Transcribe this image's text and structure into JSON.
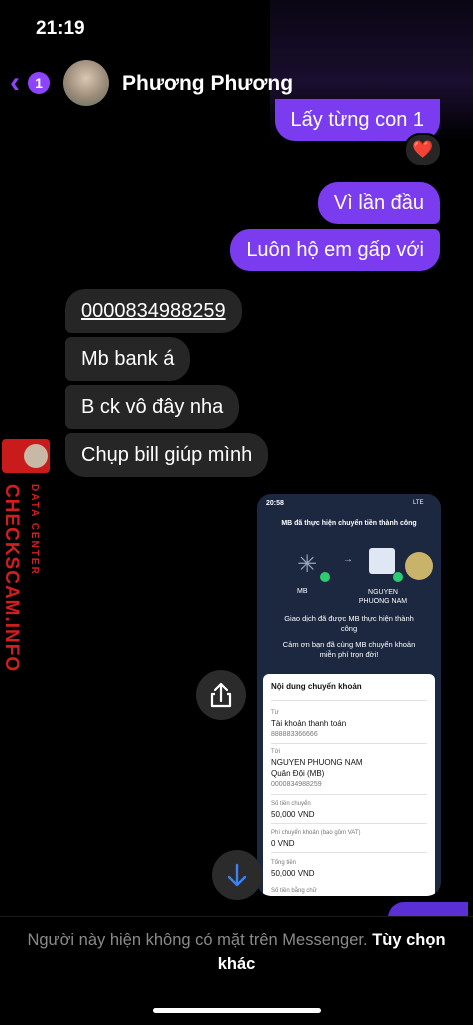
{
  "status": {
    "time": "21:19"
  },
  "header": {
    "back_count": "1",
    "contact_name": "Phương Phương"
  },
  "messages": {
    "out": [
      "Lấy từng con 1",
      "Vì lần đầu",
      "Luôn hộ em gấp với"
    ],
    "reaction": "❤️",
    "in": [
      "0000834988259",
      "Mb bank á",
      "B ck vô đây nha",
      "Chụp bill giúp mình"
    ]
  },
  "watermark": {
    "title": "CHECKSCAM.INFO",
    "subtitle": "DATA CENTER"
  },
  "screenshot": {
    "time": "20:58",
    "network": "LTE",
    "heading": "MB đã thực hiện chuyển tiền thành công",
    "from_bank": "MB",
    "to_name": "NGUYEN PHUONG NAM",
    "msg1": "Giao dịch đã được MB thực hiện thành công",
    "msg2": "Cảm ơn bạn đã cùng MB chuyển khoản miễn phí trọn đời!",
    "card_title": "Nội dung chuyển khoản",
    "from_label": "Từ",
    "from_account": "Tài khoản thanh toán",
    "from_number": "888883366666",
    "to_label": "Tới",
    "to_bank": "Quân Đội (MB)",
    "to_number": "0000834988259",
    "amount_label": "Số tiền chuyển",
    "amount": "50,000 VND",
    "fee_label": "Phí chuyển khoản (bao gồm VAT)",
    "fee": "0 VND",
    "total_label": "Tổng tiền",
    "total": "50,000 VND",
    "words_label": "Số tiền bằng chữ"
  },
  "footer": {
    "notice": "Người này hiện không có mặt trên Messenger.",
    "more": "Tùy chọn khác"
  },
  "colors": {
    "accent": "#7b3cf0",
    "incoming": "#262626",
    "watermark": "#d01f1f"
  }
}
